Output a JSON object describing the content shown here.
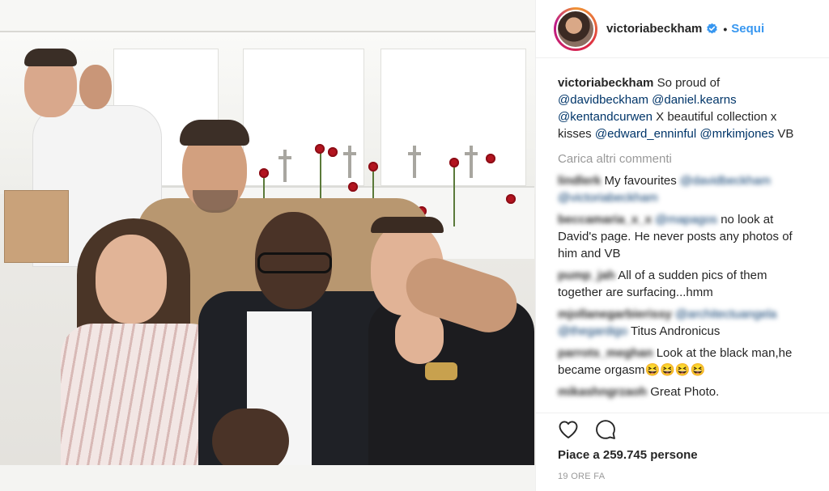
{
  "post": {
    "username": "victoriabeckham",
    "follow_label": "Sequi",
    "caption": {
      "username": "victoriabeckham",
      "text_1": "So proud of",
      "mention_1": "@davidbeckham",
      "mention_2": "@daniel.kearns",
      "mention_3": "@kentandcurwen",
      "text_2": "X beautiful collection x kisses",
      "mention_4": "@edward_enninful",
      "mention_5": "@mrkimjones",
      "text_3": "VB"
    },
    "load_more_label": "Carica altri commenti",
    "comments": [
      {
        "username": "lindlerk",
        "pre": "",
        "text": "My favourites",
        "mention": "@davidbeckham @victoriabeckham",
        "post": ""
      },
      {
        "username": "beccamaria_x_x",
        "pre": "",
        "mention": "@mapagos",
        "text": "no look at David's page. He never posts any photos of him and VB",
        "post": ""
      },
      {
        "username": "pump_jah",
        "pre": "",
        "mention": "",
        "text": "All of a sudden pics of them together are surfacing...hmm",
        "post": ""
      },
      {
        "username": "mjollanegarbierissy",
        "pre": "",
        "mention": "@architectuangela @thegardigo",
        "text": "Titus Andronicus",
        "post": ""
      },
      {
        "username": "parrots_meghan",
        "pre": "",
        "mention": "",
        "text": "Look at the black man,he became orgasm😆😆😆😆",
        "post": ""
      },
      {
        "username": "mikashngrzaoh",
        "pre": "",
        "mention": "",
        "text": "Great Photo.",
        "post": ""
      }
    ],
    "likes_label": "Piace a 259.745 persone",
    "time_label": "19 ORE FA"
  },
  "icons": {
    "like": "heart-icon",
    "comment": "comment-icon",
    "verified": "verified-badge-icon"
  },
  "colors": {
    "link": "#003569",
    "follow": "#3897f0",
    "muted": "#999999",
    "text": "#262626"
  }
}
